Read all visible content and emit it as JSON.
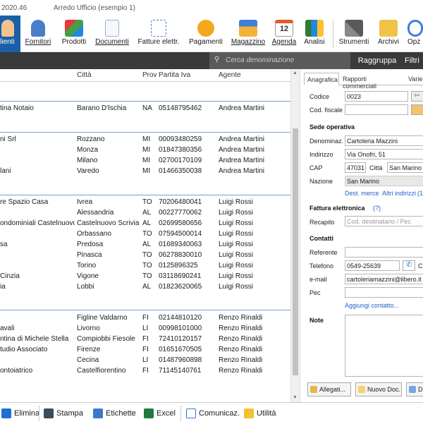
{
  "window": {
    "version": "2020.46",
    "title": "Arredo Ufficio (esempio 1)"
  },
  "ribbon": {
    "clienti": "lienti",
    "fornitori": "Fornitori",
    "prodotti": "Prodotti",
    "documenti": "Documenti",
    "fatture": "Fatture elettr.",
    "pagamenti": "Pagamenti",
    "magazzino": "Magazzino",
    "agenda": "Agenda",
    "analisi": "Analisi",
    "strumenti": "Strumenti",
    "archivi": "Archivi",
    "opzioni": "Opz",
    "calendar_day": "12"
  },
  "toolbar": {
    "search_placeholder": "Cerca denominazione",
    "raggruppa": "Raggruppa",
    "filtri": "Filtri"
  },
  "grid": {
    "headers": {
      "citta": "Città",
      "prov": "Prov",
      "piva": "Partita Iva",
      "agente": "Agente"
    },
    "rows": [
      {
        "denom": "tina Notaio",
        "citta": "Barano D'Ischia",
        "prov": "NA",
        "piva": "05148795462",
        "agente": "Andrea Martini"
      },
      {
        "denom": "ni Srl",
        "citta": "Rozzano",
        "prov": "MI",
        "piva": "00093480259",
        "agente": "Andrea Martini"
      },
      {
        "denom": "",
        "citta": "Monza",
        "prov": "MI",
        "piva": "01847380356",
        "agente": "Andrea Martini"
      },
      {
        "denom": "",
        "citta": "Milano",
        "prov": "MI",
        "piva": "02700170109",
        "agente": "Andrea Martini"
      },
      {
        "denom": "lani",
        "citta": "Varedo",
        "prov": "MI",
        "piva": "01466350038",
        "agente": "Andrea Martini"
      },
      {
        "denom": "re Spazio Casa",
        "citta": "Ivrea",
        "prov": "TO",
        "piva": "70206480041",
        "agente": "Luigi Rossi"
      },
      {
        "denom": "",
        "citta": "Alessandria",
        "prov": "AL",
        "piva": "00227770062",
        "agente": "Luigi Rossi"
      },
      {
        "denom": "ondominiali Castelnuovo",
        "citta": "Castelnuovo Scrivia",
        "prov": "AL",
        "piva": "02699580656",
        "agente": "Luigi Rossi"
      },
      {
        "denom": "",
        "citta": "Orbassano",
        "prov": "TO",
        "piva": "07594500014",
        "agente": "Luigi Rossi"
      },
      {
        "denom": "sa",
        "citta": "Predosa",
        "prov": "AL",
        "piva": "01689340063",
        "agente": "Luigi Rossi"
      },
      {
        "denom": "",
        "citta": "Pinasca",
        "prov": "TO",
        "piva": "06278830010",
        "agente": "Luigi Rossi"
      },
      {
        "denom": "",
        "citta": "Torino",
        "prov": "TO",
        "piva": "0125896325",
        "agente": "Luigi Rossi"
      },
      {
        "denom": "Cinzia",
        "citta": "Vigone",
        "prov": "TO",
        "piva": "03118690241",
        "agente": "Luigi Rossi"
      },
      {
        "denom": "ia",
        "citta": "Lobbi",
        "prov": "AL",
        "piva": "01823620065",
        "agente": "Luigi Rossi"
      },
      {
        "denom": "",
        "citta": "Figline Valdarno",
        "prov": "FI",
        "piva": "02144810120",
        "agente": "Renzo Rinaldi"
      },
      {
        "denom": "avali",
        "citta": "Livorno",
        "prov": "LI",
        "piva": "00998101000",
        "agente": "Renzo Rinaldi"
      },
      {
        "denom": "ntina di Michele Stella",
        "citta": "Compiobbi Fiesole",
        "prov": "FI",
        "piva": "72410120157",
        "agente": "Renzo Rinaldi"
      },
      {
        "denom": "tudio Associato",
        "citta": "Firenze",
        "prov": "FI",
        "piva": "01651670505",
        "agente": "Renzo Rinaldi"
      },
      {
        "denom": "",
        "citta": "Cecina",
        "prov": "LI",
        "piva": "01487960898",
        "agente": "Renzo Rinaldi"
      },
      {
        "denom": "ontoiatrico",
        "citta": "Castelfiorentino",
        "prov": "FI",
        "piva": "71145140761",
        "agente": "Renzo Rinaldi"
      }
    ]
  },
  "panel": {
    "tabs": [
      "Anagrafica",
      "Rapporti commerciali",
      "Varie"
    ],
    "codice_label": "Codice",
    "codice": "0023",
    "codfiscale_label": "Cod. fiscale",
    "sede_title": "Sede operativa",
    "denominaz_label": "Denominaz.",
    "denominaz": "Cartoleria Mazzini",
    "indirizzo_label": "Indirizzo",
    "indirizzo": "Via Onofri, 51",
    "cap_label": "CAP",
    "cap": "47031",
    "citta_label": "Città",
    "citta": "San Marino",
    "nazione_label": "Nazione",
    "nazione": "San Marino",
    "dest_merce": "Dest. merce",
    "altri_indirizzi": "Altri indirizzi",
    "altri_count": "(1",
    "fattura_title": "Fattura elettronica",
    "fattura_help": "(?)",
    "recapito_label": "Recapito",
    "recapito_placeholder": "Cod. destinatario / Pec",
    "contatti_title": "Contatti",
    "referente_label": "Referente",
    "telefono_label": "Telefono",
    "telefono": "0549-25639",
    "email_label": "e-mail",
    "email": "cartoleriamazzini@libero.it",
    "pec_label": "Pec",
    "aggiungi": "Aggiungi contatto...",
    "note_title": "Note",
    "btn_allegati": "Allegati...",
    "btn_nuovo": "Nuovo Doc.",
    "btn_d": "D"
  },
  "bottom": {
    "elimina": "Elimina",
    "stampa": "Stampa",
    "etichette": "Etichette",
    "excel": "Excel",
    "comunicaz": "Comunicaz.",
    "utilita": "Utilità"
  }
}
